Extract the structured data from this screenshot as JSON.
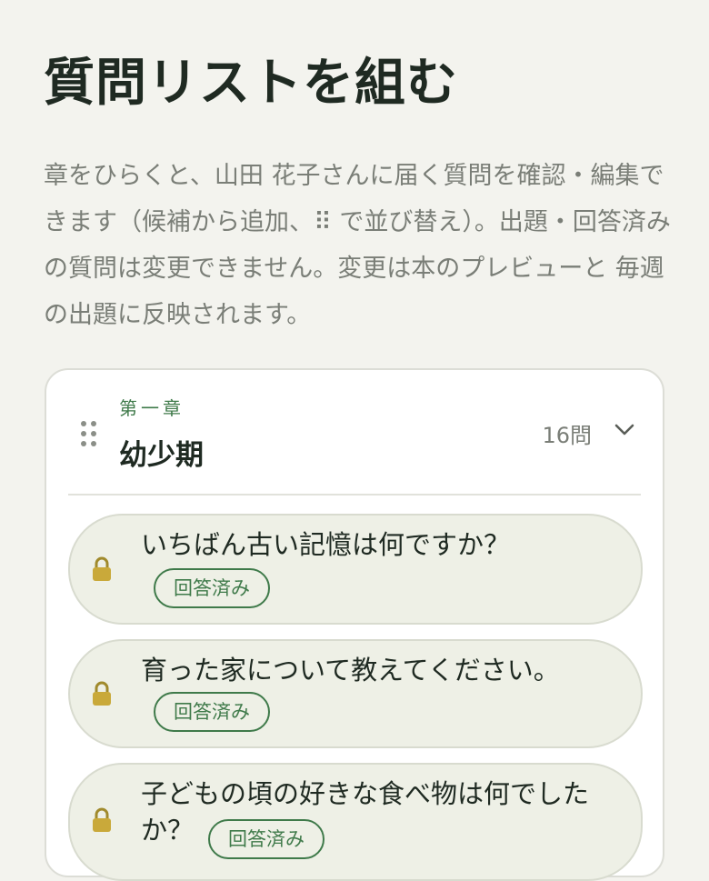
{
  "page": {
    "title": "質問リストを組む",
    "description": "章をひらくと、山田 花子さんに届く質問を確認・編集できます（候補から追加、⠿ で並び替え）。出題・回答済みの質問は変更できません。変更は本のプレビューと 毎週の出題に反映されます。"
  },
  "chapter": {
    "label": "第一章",
    "title": "幼少期",
    "count": "16問",
    "questions": [
      {
        "text": "いちばん古い記憶は何ですか？",
        "status": "回答済み",
        "locked": true
      },
      {
        "text": "育った家について教えてください。",
        "status": "回答済み",
        "locked": true
      },
      {
        "text": "子どもの頃の好きな食べ物は何でしたか？",
        "status": "回答済み",
        "locked": true
      }
    ]
  },
  "icons": {
    "drag": "drag-handle-icon",
    "expand": "chevron-down-icon",
    "lock": "lock-icon"
  },
  "colors": {
    "background": "#f3f3ee",
    "accent": "#3f7a4a",
    "question_fill": "#eef0e6",
    "muted_text": "#7a7e77"
  }
}
